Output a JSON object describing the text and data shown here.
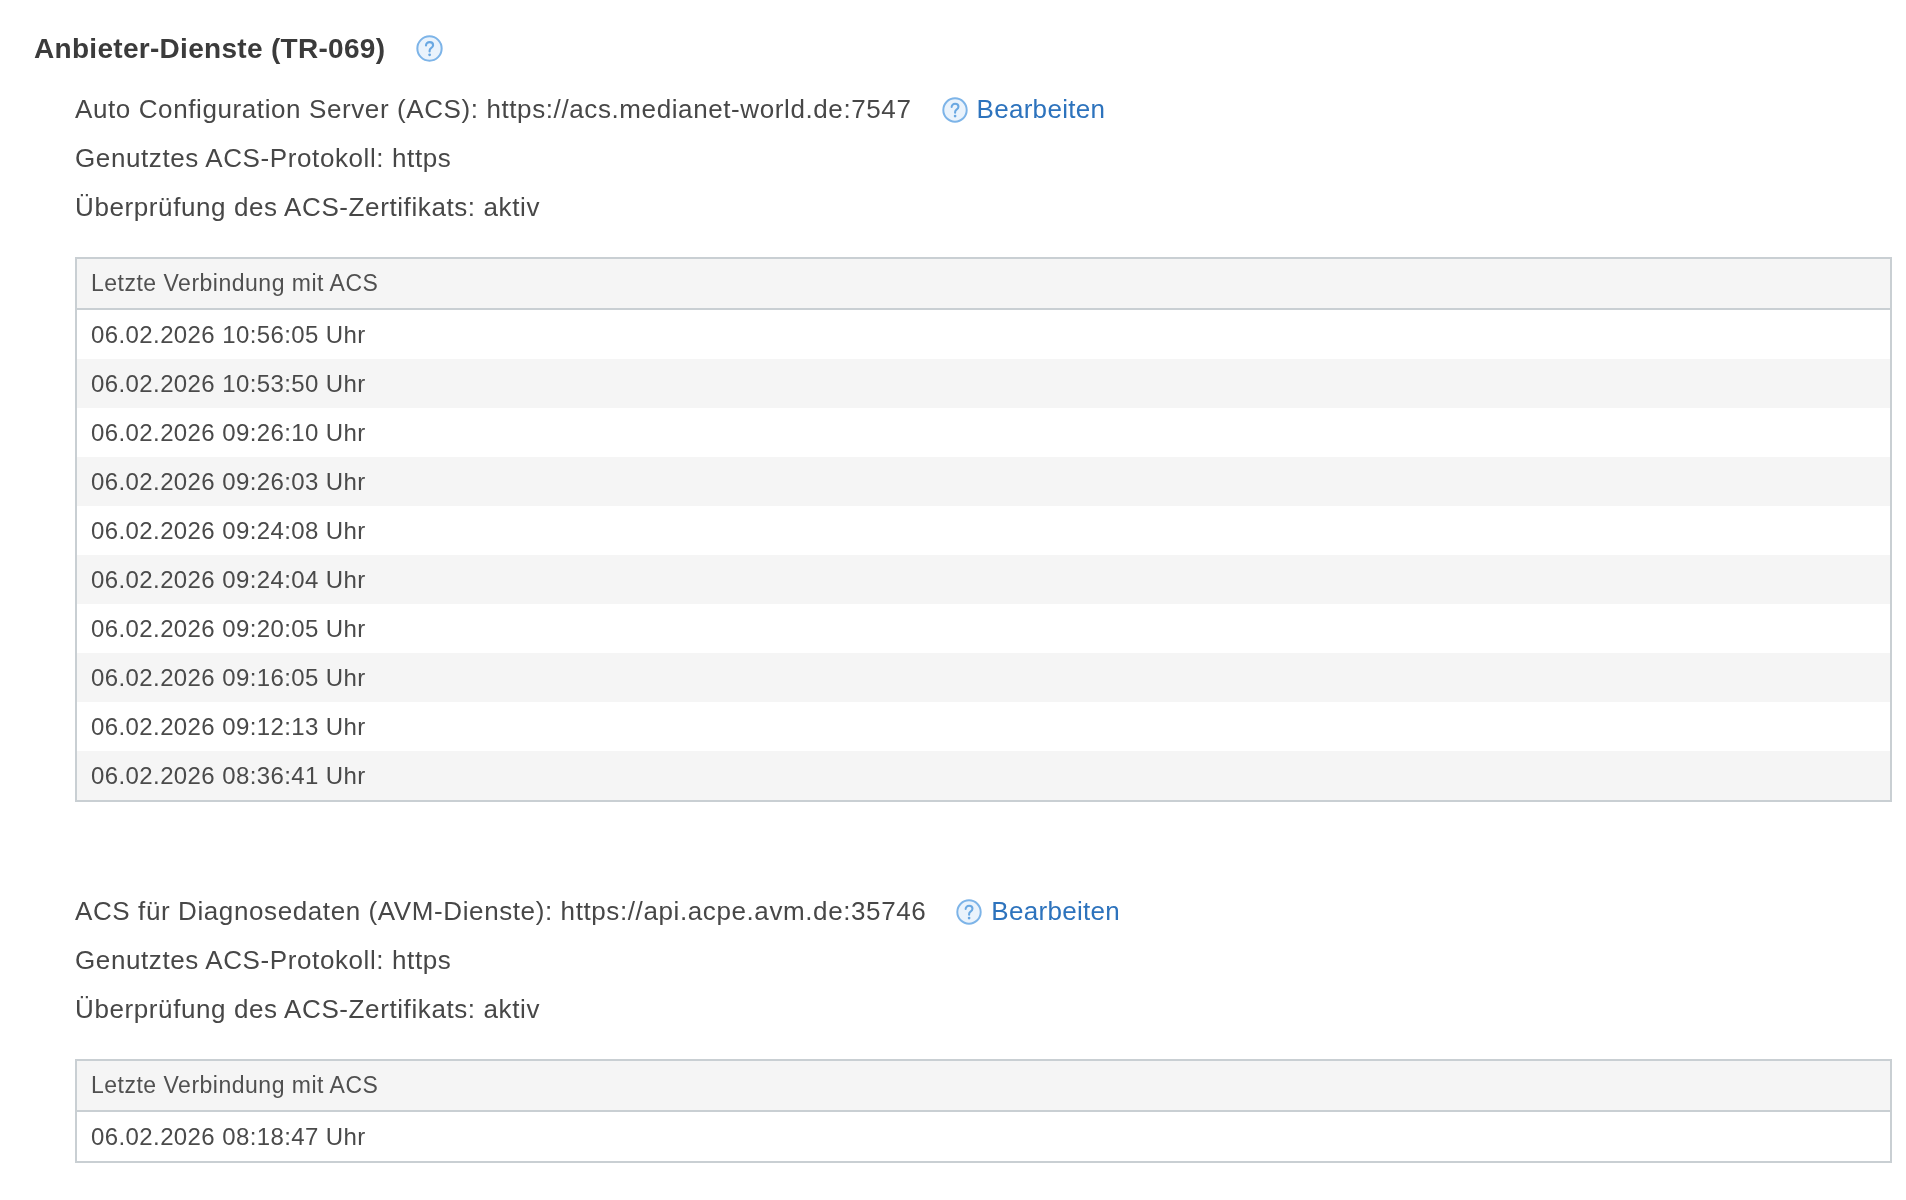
{
  "title": "Anbieter-Dienste (TR-069)",
  "sections": [
    {
      "server": "Auto Configuration Server (ACS): https://acs.medianet-world.de:7547",
      "edit_link": "Bearbeiten",
      "details": [
        "Genutztes ACS-Protokoll: https",
        "Überprüfung des ACS-Zertifikats: aktiv"
      ],
      "table": {
        "columns": [
          "Letzte Verbindung mit ACS"
        ],
        "rows": [
          [
            "06.02.2026 10:56:05 Uhr"
          ],
          [
            "06.02.2026 10:53:50 Uhr"
          ],
          [
            "06.02.2026 09:26:10 Uhr"
          ],
          [
            "06.02.2026 09:26:03 Uhr"
          ],
          [
            "06.02.2026 09:24:08 Uhr"
          ],
          [
            "06.02.2026 09:24:04 Uhr"
          ],
          [
            "06.02.2026 09:20:05 Uhr"
          ],
          [
            "06.02.2026 09:16:05 Uhr"
          ],
          [
            "06.02.2026 09:12:13 Uhr"
          ],
          [
            "06.02.2026 08:36:41 Uhr"
          ]
        ]
      }
    },
    {
      "server": "ACS für Diagnosedaten (AVM-Dienste): https://api.acpe.avm.de:35746",
      "edit_link": "Bearbeiten",
      "details": [
        "Genutztes ACS-Protokoll: https",
        "Überprüfung des ACS-Zertifikats: aktiv"
      ],
      "table": {
        "columns": [
          "Letzte Verbindung mit ACS"
        ],
        "rows": [
          [
            "06.02.2026 08:18:47 Uhr"
          ]
        ]
      }
    }
  ]
}
